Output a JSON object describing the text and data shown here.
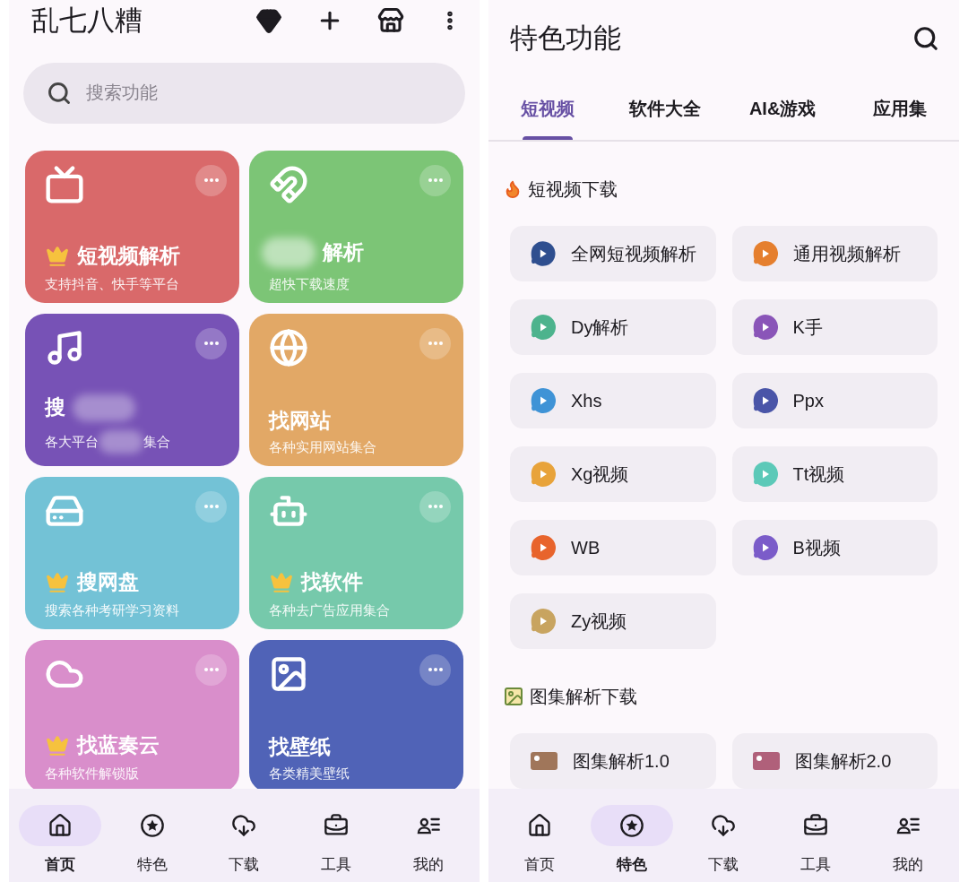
{
  "left_screen": {
    "title": "乱七八糟",
    "search": {
      "placeholder": "搜索功能"
    },
    "cards": [
      {
        "title": "短视频解析",
        "subtitle": "支持抖音、快手等平台",
        "vip": true,
        "redacted": false,
        "color": "#d9696a"
      },
      {
        "title": "解析",
        "subtitle": "超快下载速度",
        "vip": false,
        "redacted": true,
        "color": "#7cc576"
      },
      {
        "title": "搜",
        "subtitle": "各大平台",
        "subtitle_end": "集合",
        "vip": false,
        "redacted": true,
        "color": "#7752b6"
      },
      {
        "title": "找网站",
        "subtitle": "各种实用网站集合",
        "vip": false,
        "redacted": false,
        "color": "#e2a866"
      },
      {
        "title": "搜网盘",
        "subtitle": "搜索各种考研学习资料",
        "vip": true,
        "redacted": false,
        "color": "#73c2d6"
      },
      {
        "title": "找软件",
        "subtitle": "各种去广告应用集合",
        "vip": true,
        "redacted": false,
        "color": "#76c9ab"
      },
      {
        "title": "找蓝奏云",
        "subtitle": "各种软件解锁版",
        "vip": true,
        "redacted": false,
        "color": "#d98ecb"
      },
      {
        "title": "找壁纸",
        "subtitle": "各类精美壁纸",
        "vip": false,
        "redacted": false,
        "color": "#5063b7"
      }
    ],
    "nav": [
      {
        "label": "首页",
        "selected": true
      },
      {
        "label": "特色",
        "selected": false
      },
      {
        "label": "下载",
        "selected": false
      },
      {
        "label": "工具",
        "selected": false
      },
      {
        "label": "我的",
        "selected": false
      }
    ]
  },
  "right_screen": {
    "title": "特色功能",
    "tabs": [
      {
        "label": "短视频",
        "selected": true
      },
      {
        "label": "软件大全",
        "selected": false
      },
      {
        "label": "AI&游戏",
        "selected": false
      },
      {
        "label": "应用集",
        "selected": false
      }
    ],
    "sections": [
      {
        "title": "短视频下载",
        "kind": "video",
        "items": [
          {
            "label": "全网短视频解析",
            "color": "#2f4f8f"
          },
          {
            "label": "通用视频解析",
            "color": "#e57f2e"
          },
          {
            "label": "Dy解析",
            "color": "#4db38d"
          },
          {
            "label": "K手",
            "color": "#8a55b8"
          },
          {
            "label": "Xhs",
            "color": "#3f93d6"
          },
          {
            "label": "Ppx",
            "color": "#4a55a8"
          },
          {
            "label": "Xg视频",
            "color": "#e8a33a"
          },
          {
            "label": "Tt视频",
            "color": "#5cc9b8"
          },
          {
            "label": "WB",
            "color": "#e8642c"
          },
          {
            "label": "B视频",
            "color": "#7b5cc9"
          },
          {
            "label": "Zy视频",
            "color": "#c8a460"
          }
        ]
      },
      {
        "title": "图集解析下载",
        "kind": "image",
        "items": [
          {
            "label": "图集解析1.0",
            "color": "#a0765a"
          },
          {
            "label": "图集解析2.0",
            "color": "#b0607a"
          }
        ]
      }
    ],
    "nav": [
      {
        "label": "首页",
        "selected": false
      },
      {
        "label": "特色",
        "selected": true
      },
      {
        "label": "下载",
        "selected": false
      },
      {
        "label": "工具",
        "selected": false
      },
      {
        "label": "我的",
        "selected": false
      }
    ]
  }
}
